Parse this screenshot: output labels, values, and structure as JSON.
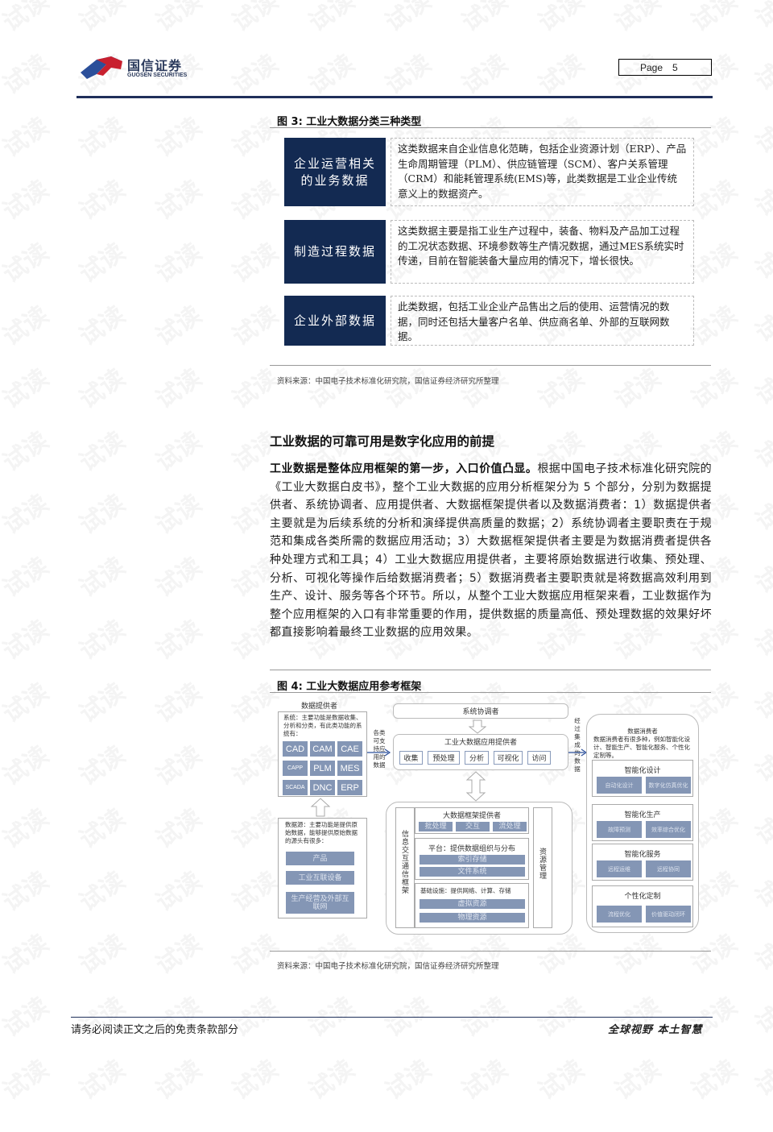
{
  "header": {
    "logo_cn": "国信证券",
    "logo_en": "GUOSEN SECURITIES",
    "page_label": "Page",
    "page_number": "5",
    "brand_colors": {
      "navy": "#1f2f5a",
      "red": "#c8202f",
      "blue": "#2b4f9a"
    }
  },
  "figure3": {
    "title": "图 3:  工业大数据分类三种类型",
    "rows": [
      {
        "category": "企业运营相关的业务数据",
        "category_lines": [
          "企业运营相关",
          "的业务数据"
        ],
        "description": "这类数据来自企业信息化范畴，包括企业资源计划（ERP）、产品生命周期管理（PLM）、供应链管理（SCM）、客户关系管理（CRM）和能耗管理系统(EMS)等，此类数据是工业企业传统意义上的数据资产。"
      },
      {
        "category": "制造过程数据",
        "category_lines": [
          "制造过程数据"
        ],
        "description": "这类数据主要是指工业生产过程中，装备、物料及产品加工过程的工况状态数据、环境参数等生产情况数据，通过MES系统实时传递，目前在智能装备大量应用的情况下，增长很快。"
      },
      {
        "category": "企业外部数据",
        "category_lines": [
          "企业外部数据"
        ],
        "description": "此类数据，包括工业企业产品售出之后的使用、运营情况的数据，同时还包括大量客户名单、供应商名单、外部的互联网数据。"
      }
    ],
    "source": "资料来源：中国电子技术标准化研究院，国信证券经济研究所整理",
    "category_color": "#132a52"
  },
  "section": {
    "heading": "工业数据的可靠可用是数字化应用的前提",
    "lead_bold": "工业数据是整体应用框架的第一步，入口价值凸显。",
    "body": "根据中国电子技术标准化研究院的《工业大数据白皮书》，整个工业大数据的应用分析框架分为 5 个部分，分别为数据提供者、系统协调者、应用提供者、大数据框架提供者以及数据消费者：1）数据提供者主要就是为后续系统的分析和演绎提供高质量的数据；2）系统协调者主要职责在于规范和集成各类所需的数据应用活动；3）大数据框架提供者主要是为数据消费者提供各种处理方式和工具；4）工业大数据应用提供者，主要将原始数据进行收集、预处理、分析、可视化等操作后给数据消费者；5）数据消费者主要职责就是将数据高效利用到生产、设计、服务等各个环节。所以，从整个工业大数据应用框架来看，工业数据作为整个应用框架的入口有非常重要的作用，提供数据的质量高低、预处理数据的效果好坏都直接影响着最终工业数据的应用效果。"
  },
  "figure4": {
    "title": "图 4:  工业大数据应用参考框架",
    "data_provider": {
      "title": "数据提供者",
      "systems_desc": "系统：主要功能是数据收集、分析和分类，有此类功能的系统有：",
      "systems": [
        "CAD",
        "CAM",
        "CAE",
        "CAPP",
        "PLM",
        "MES",
        "SCADA",
        "DNC",
        "ERP"
      ],
      "sources_desc": "数据源：主要功能是提供原始数据，能够提供原始数据的源头有很多：",
      "sources": [
        "产品",
        "工业互联设备",
        "生产经营及外部互联网"
      ]
    },
    "arrow_left_label": "各类可支持应用的数据",
    "arrow_right_label": "经过集成的数据",
    "coordinator": "系统协调者",
    "app_provider": {
      "title": "工业大数据应用提供者",
      "steps": [
        "收集",
        "预处理",
        "分析",
        "可视化",
        "访问"
      ]
    },
    "framework": {
      "left_label": "信息交互通信框架",
      "right_label": "资源管理",
      "title": "大数据框架提供者",
      "processing": [
        "批处理",
        "交互",
        "流处理"
      ],
      "platform_title": "平台：提供数据组织与分布",
      "platform_items": [
        "索引存储",
        "文件系统"
      ],
      "infra_title": "基础设施：提供网络、计算、存储",
      "infra_items": [
        "虚拟资源",
        "物理资源"
      ]
    },
    "consumer": {
      "title": "数据消费者",
      "desc": "数据消费者有很多种，例如智能化设计、智能生产、智能化服务、个性化定制等。",
      "groups": [
        {
          "name": "智能化设计",
          "items": [
            "自动化设计",
            "数字化仿真优化"
          ]
        },
        {
          "name": "智能化生产",
          "items": [
            "故障预测",
            "效率综合优化"
          ]
        },
        {
          "name": "智能化服务",
          "items": [
            "远程运维",
            "远程协同"
          ]
        },
        {
          "name": "个性化定制",
          "items": [
            "流程优化",
            "价值驱动闭环"
          ]
        }
      ]
    },
    "chip_color": "#8496b5",
    "source": "资料来源：中国电子技术标准化研究院，国信证券经济研究所整理"
  },
  "footer": {
    "disclaimer": "请务必阅读正文之后的免责条款部分",
    "slogan": "全球视野  本土智慧"
  },
  "watermark_text": "试读"
}
